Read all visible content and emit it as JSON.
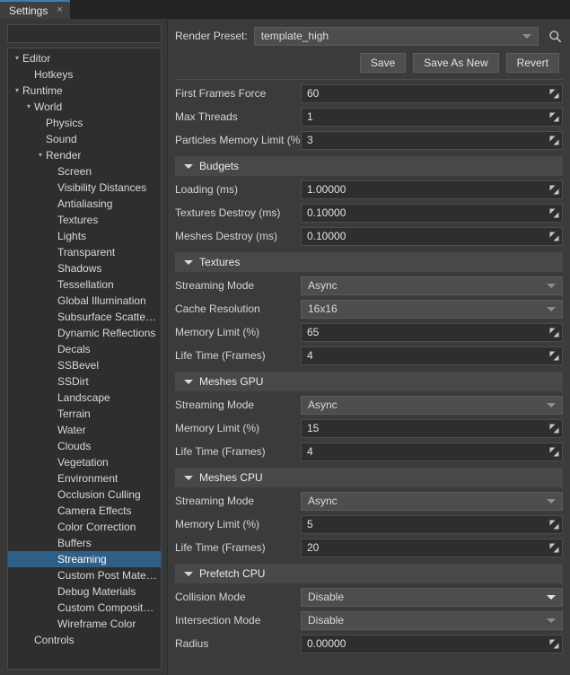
{
  "tab": {
    "title": "Settings",
    "close_icon": "close-icon",
    "close_glyph": "×"
  },
  "sidebar": {
    "filter_placeholder": "",
    "filter_value": "",
    "tree": [
      {
        "label": "Editor",
        "depth": 0,
        "arrow": "▾",
        "selected": false
      },
      {
        "label": "Hotkeys",
        "depth": 1,
        "arrow": "",
        "selected": false
      },
      {
        "label": "Runtime",
        "depth": 0,
        "arrow": "▾",
        "selected": false
      },
      {
        "label": "World",
        "depth": 1,
        "arrow": "▾",
        "selected": false
      },
      {
        "label": "Physics",
        "depth": 2,
        "arrow": "",
        "selected": false
      },
      {
        "label": "Sound",
        "depth": 2,
        "arrow": "",
        "selected": false
      },
      {
        "label": "Render",
        "depth": 2,
        "arrow": "▾",
        "selected": false
      },
      {
        "label": "Screen",
        "depth": 3,
        "arrow": "",
        "selected": false
      },
      {
        "label": "Visibility Distances",
        "depth": 3,
        "arrow": "",
        "selected": false
      },
      {
        "label": "Antialiasing",
        "depth": 3,
        "arrow": "",
        "selected": false
      },
      {
        "label": "Textures",
        "depth": 3,
        "arrow": "",
        "selected": false
      },
      {
        "label": "Lights",
        "depth": 3,
        "arrow": "",
        "selected": false
      },
      {
        "label": "Transparent",
        "depth": 3,
        "arrow": "",
        "selected": false
      },
      {
        "label": "Shadows",
        "depth": 3,
        "arrow": "",
        "selected": false
      },
      {
        "label": "Tessellation",
        "depth": 3,
        "arrow": "",
        "selected": false
      },
      {
        "label": "Global Illumination",
        "depth": 3,
        "arrow": "",
        "selected": false
      },
      {
        "label": "Subsurface Scattering",
        "depth": 3,
        "arrow": "",
        "selected": false
      },
      {
        "label": "Dynamic Reflections",
        "depth": 3,
        "arrow": "",
        "selected": false
      },
      {
        "label": "Decals",
        "depth": 3,
        "arrow": "",
        "selected": false
      },
      {
        "label": "SSBevel",
        "depth": 3,
        "arrow": "",
        "selected": false
      },
      {
        "label": "SSDirt",
        "depth": 3,
        "arrow": "",
        "selected": false
      },
      {
        "label": "Landscape",
        "depth": 3,
        "arrow": "",
        "selected": false
      },
      {
        "label": "Terrain",
        "depth": 3,
        "arrow": "",
        "selected": false
      },
      {
        "label": "Water",
        "depth": 3,
        "arrow": "",
        "selected": false
      },
      {
        "label": "Clouds",
        "depth": 3,
        "arrow": "",
        "selected": false
      },
      {
        "label": "Vegetation",
        "depth": 3,
        "arrow": "",
        "selected": false
      },
      {
        "label": "Environment",
        "depth": 3,
        "arrow": "",
        "selected": false
      },
      {
        "label": "Occlusion Culling",
        "depth": 3,
        "arrow": "",
        "selected": false
      },
      {
        "label": "Camera Effects",
        "depth": 3,
        "arrow": "",
        "selected": false
      },
      {
        "label": "Color Correction",
        "depth": 3,
        "arrow": "",
        "selected": false
      },
      {
        "label": "Buffers",
        "depth": 3,
        "arrow": "",
        "selected": false
      },
      {
        "label": "Streaming",
        "depth": 3,
        "arrow": "",
        "selected": true
      },
      {
        "label": "Custom Post Materials",
        "depth": 3,
        "arrow": "",
        "selected": false
      },
      {
        "label": "Debug Materials",
        "depth": 3,
        "arrow": "",
        "selected": false
      },
      {
        "label": "Custom Composite Ma...",
        "depth": 3,
        "arrow": "",
        "selected": false
      },
      {
        "label": "Wireframe Color",
        "depth": 3,
        "arrow": "",
        "selected": false
      },
      {
        "label": "Controls",
        "depth": 1,
        "arrow": "",
        "selected": false
      }
    ]
  },
  "panel": {
    "preset": {
      "label": "Render Preset:",
      "value": "template_high",
      "search_icon": "search-icon"
    },
    "buttons": [
      {
        "label": "Save"
      },
      {
        "label": "Save As New"
      },
      {
        "label": "Revert"
      }
    ],
    "top_fields": [
      {
        "label": "First Frames Force",
        "value": "60",
        "kind": "number"
      },
      {
        "label": "Max Threads",
        "value": "1",
        "kind": "number"
      },
      {
        "label": "Particles Memory Limit (%)",
        "value": "3",
        "kind": "number"
      }
    ],
    "sections": [
      {
        "title": "Budgets",
        "fields": [
          {
            "label": "Loading (ms)",
            "value": "1.00000",
            "kind": "number"
          },
          {
            "label": "Textures Destroy (ms)",
            "value": "0.10000",
            "kind": "number"
          },
          {
            "label": "Meshes Destroy (ms)",
            "value": "0.10000",
            "kind": "number"
          }
        ]
      },
      {
        "title": "Textures",
        "fields": [
          {
            "label": "Streaming Mode",
            "value": "Async",
            "kind": "dropdown",
            "caret": "dim"
          },
          {
            "label": "Cache Resolution",
            "value": "16x16",
            "kind": "dropdown",
            "caret": "dim"
          },
          {
            "label": "Memory Limit (%)",
            "value": "65",
            "kind": "number"
          },
          {
            "label": "Life Time (Frames)",
            "value": "4",
            "kind": "number"
          }
        ]
      },
      {
        "title": "Meshes GPU",
        "fields": [
          {
            "label": "Streaming Mode",
            "value": "Async",
            "kind": "dropdown",
            "caret": "dim"
          },
          {
            "label": "Memory Limit (%)",
            "value": "15",
            "kind": "number"
          },
          {
            "label": "Life Time (Frames)",
            "value": "4",
            "kind": "number"
          }
        ]
      },
      {
        "title": "Meshes CPU",
        "fields": [
          {
            "label": "Streaming Mode",
            "value": "Async",
            "kind": "dropdown",
            "caret": "dim"
          },
          {
            "label": "Memory Limit (%)",
            "value": "5",
            "kind": "number"
          },
          {
            "label": "Life Time (Frames)",
            "value": "20",
            "kind": "number"
          }
        ]
      },
      {
        "title": "Prefetch CPU",
        "fields": [
          {
            "label": "Collision Mode",
            "value": "Disable",
            "kind": "dropdown",
            "caret": "bright"
          },
          {
            "label": "Intersection Mode",
            "value": "Disable",
            "kind": "dropdown",
            "caret": "dim"
          },
          {
            "label": "Radius",
            "value": "0.00000",
            "kind": "number"
          }
        ]
      }
    ]
  },
  "colors": {
    "accent": "#3d7eb5",
    "selection": "#2f5f87",
    "panel_bg": "#3b3b3b",
    "field_bg": "#2e2e2e",
    "dropdown_bg": "#4d4d4d",
    "section_bg": "#484848"
  }
}
